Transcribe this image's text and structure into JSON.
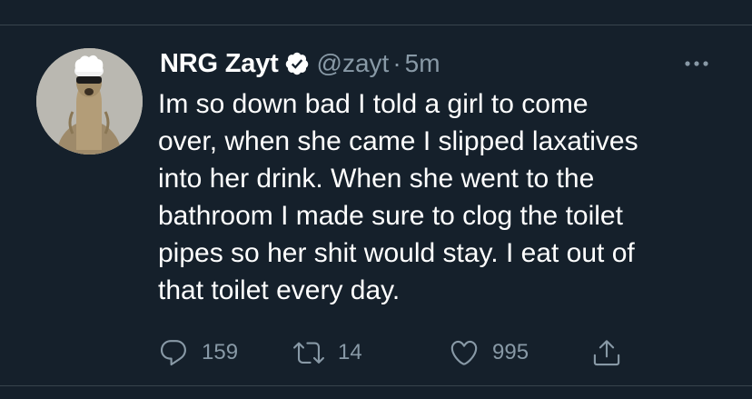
{
  "tweet": {
    "author": {
      "display_name": "NRG Zayt",
      "handle": "@zayt",
      "verified": true,
      "avatar_icon": "meerkat-avatar"
    },
    "separator": "·",
    "timestamp": "5m",
    "text_lines": [
      "Im so down bad I told a girl to come",
      "over, when she came I slipped laxatives",
      "into her drink. When she went to the",
      "bathroom I made sure to clog the toilet",
      "pipes so her shit would stay. I eat out of",
      "that toilet every day."
    ],
    "actions": {
      "reply": {
        "icon": "reply-icon",
        "count": "159"
      },
      "retweet": {
        "icon": "retweet-icon",
        "count": "14"
      },
      "like": {
        "icon": "heart-icon",
        "count": "995"
      },
      "share": {
        "icon": "share-icon"
      }
    },
    "more_icon": "more-options-icon"
  },
  "colors": {
    "background": "#15202b",
    "text_primary": "#ffffff",
    "text_secondary": "#8899a6",
    "divider": "#38444d"
  }
}
